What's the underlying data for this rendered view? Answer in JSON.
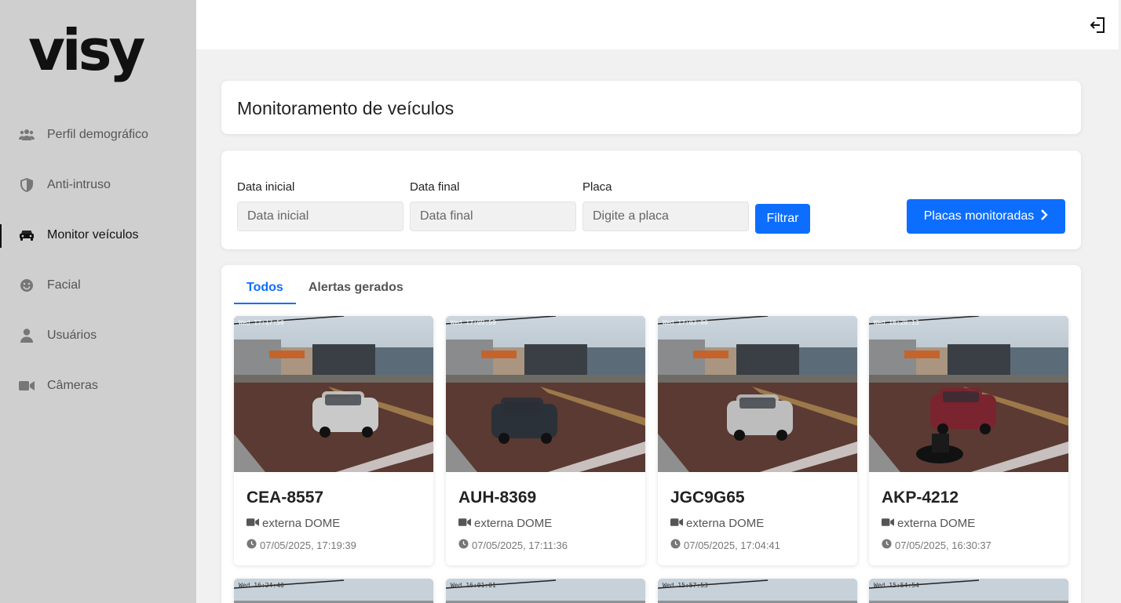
{
  "brand": {
    "logo_text": "visy"
  },
  "sidebar": {
    "items": [
      {
        "label": "Perfil demográfico",
        "icon": "users-icon",
        "active": false
      },
      {
        "label": "Anti-intruso",
        "icon": "shield-icon",
        "active": false
      },
      {
        "label": "Monitor veículos",
        "icon": "car-icon",
        "active": true
      },
      {
        "label": "Facial",
        "icon": "smile-icon",
        "active": false
      },
      {
        "label": "Usuários",
        "icon": "user-icon",
        "active": false
      },
      {
        "label": "Câmeras",
        "icon": "video-camera-icon",
        "active": false
      }
    ]
  },
  "topbar": {
    "logout_icon": "logout-icon"
  },
  "page": {
    "title": "Monitoramento de veículos"
  },
  "filters": {
    "start_label": "Data inicial",
    "start_placeholder": "Data inicial",
    "end_label": "Data final",
    "end_placeholder": "Data final",
    "plate_label": "Placa",
    "plate_placeholder": "Digite a placa",
    "filter_button": "Filtrar",
    "monitored_button": "Placas monitoradas"
  },
  "tabs": [
    {
      "label": "Todos",
      "active": true
    },
    {
      "label": "Alertas gerados",
      "active": false
    }
  ],
  "vehicles": [
    {
      "plate": "CEA-8557",
      "camera": "externa DOME",
      "datetime": "07/05/2025, 17:19:39",
      "stamp": "Wed 17:17:50",
      "car_color": "#c9c9c9"
    },
    {
      "plate": "AUH-8369",
      "camera": "externa DOME",
      "datetime": "07/05/2025, 17:11:36",
      "stamp": "Wed 17:09:59",
      "car_color": "#2b3138"
    },
    {
      "plate": "JGC9G65",
      "camera": "externa DOME",
      "datetime": "07/05/2025, 17:04:41",
      "stamp": "Wed 17:03:00",
      "car_color": "#bdbdbd"
    },
    {
      "plate": "AKP-4212",
      "camera": "externa DOME",
      "datetime": "07/05/2025, 16:30:37",
      "stamp": "Wed 16:28:13",
      "car_color": "#7a2430"
    }
  ],
  "vehicles_next_row": [
    {
      "stamp": "Wed 16:24:40"
    },
    {
      "stamp": "Wed 16:01:01"
    },
    {
      "stamp": "Wed 15:57:53"
    },
    {
      "stamp": "Wed 15:54:54"
    }
  ]
}
